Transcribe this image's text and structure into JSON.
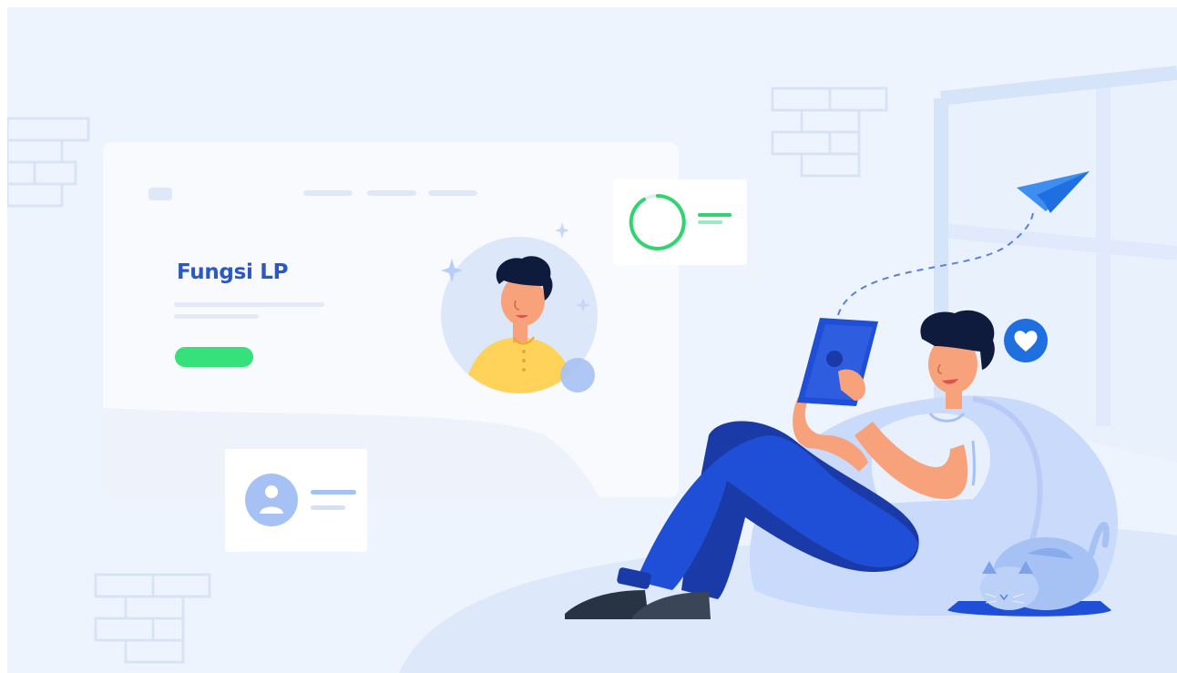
{
  "hero": {
    "title": "Fungsi LP"
  },
  "icons": [
    "brick-wall-decoration",
    "window",
    "paper-plane-icon",
    "heart-icon",
    "user-avatar-icon",
    "progress-ring-icon",
    "sparkle-icon",
    "tablet",
    "cat"
  ],
  "colors": {
    "background": "#eef4fd",
    "title": "#2a58c7",
    "button_accent": "#36e07a",
    "progress_ring": "#2fd66e",
    "primary_blue": "#1f4fd6",
    "navy_pants": "#1a3aa8",
    "skin": "#f7a27a",
    "hair": "#0f1b3d",
    "shirt_yellow": "#ffd35a"
  }
}
